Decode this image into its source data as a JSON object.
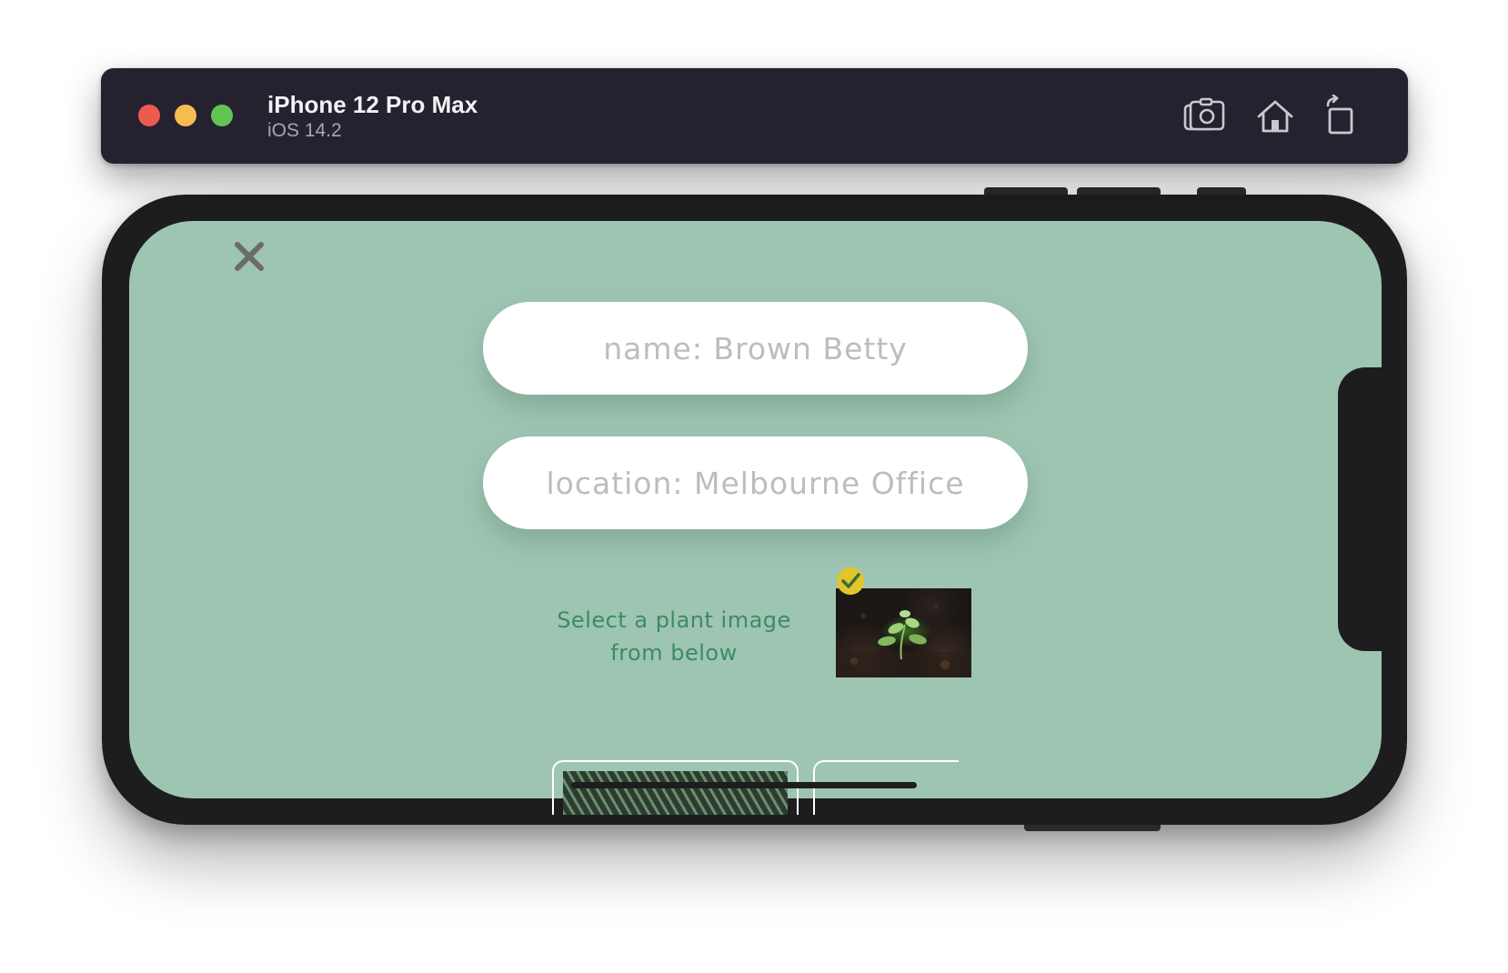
{
  "window": {
    "device_name": "iPhone 12 Pro Max",
    "os_version": "iOS 14.2",
    "toolbar": {
      "screenshot_icon": "camera-icon",
      "home_icon": "home-icon",
      "rotate_icon": "rotate-icon"
    }
  },
  "app": {
    "close_icon": "close-icon",
    "name_field": {
      "value": "",
      "placeholder": "name: Brown Betty"
    },
    "location_field": {
      "value": "",
      "placeholder": "location: Melbourne Office"
    },
    "select_label_line1": "Select a plant image",
    "select_label_line2": "from below",
    "selected_image_icon": "checkmark-icon",
    "colors": {
      "background": "#9ec5b2",
      "label_text": "#3d8a66",
      "check_badge": "#e2c52a",
      "placeholder_text": "#bdbdbd"
    }
  }
}
